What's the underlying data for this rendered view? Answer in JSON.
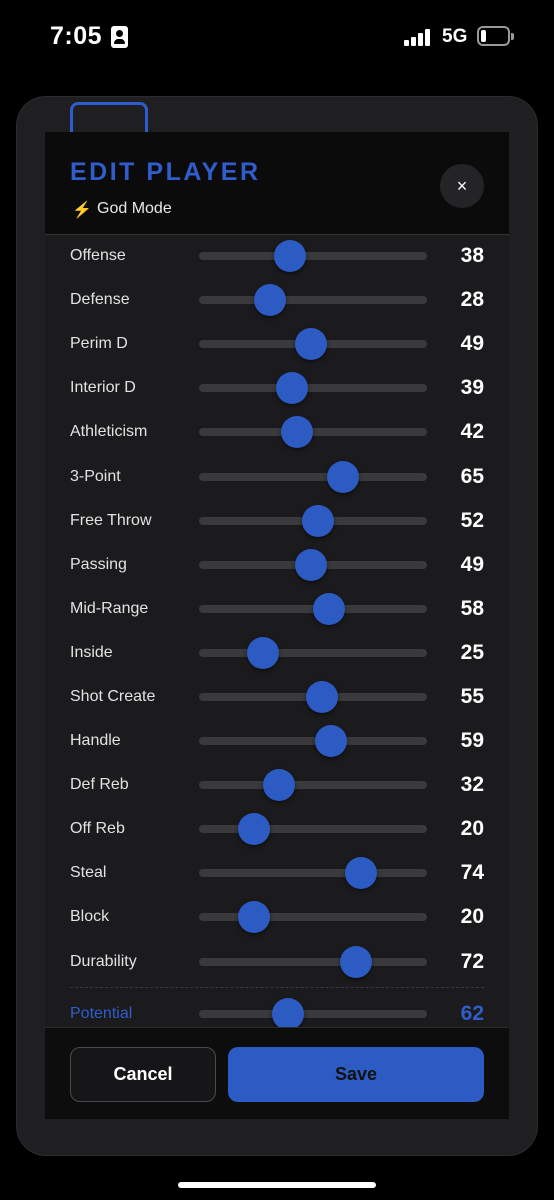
{
  "status_bar": {
    "time": "7:05",
    "network": "5G",
    "battery_level": 0.2
  },
  "modal": {
    "title": "EDIT PLAYER",
    "mode_icon": "lightning-bolt-icon",
    "mode_icon_glyph": "⚡",
    "mode_label": "God Mode",
    "close_glyph": "×",
    "accent_color": "#2d5bc4"
  },
  "attributes": [
    {
      "label": "Offense",
      "value": 38,
      "fill": 0.4
    },
    {
      "label": "Defense",
      "value": 28,
      "fill": 0.31
    },
    {
      "label": "Perim D",
      "value": 49,
      "fill": 0.49
    },
    {
      "label": "Interior D",
      "value": 39,
      "fill": 0.41
    },
    {
      "label": "Athleticism",
      "value": 42,
      "fill": 0.43
    },
    {
      "label": "3-Point",
      "value": 65,
      "fill": 0.63
    },
    {
      "label": "Free Throw",
      "value": 52,
      "fill": 0.52
    },
    {
      "label": "Passing",
      "value": 49,
      "fill": 0.49
    },
    {
      "label": "Mid-Range",
      "value": 58,
      "fill": 0.57
    },
    {
      "label": "Inside",
      "value": 25,
      "fill": 0.28
    },
    {
      "label": "Shot Create",
      "value": 55,
      "fill": 0.54
    },
    {
      "label": "Handle",
      "value": 59,
      "fill": 0.58
    },
    {
      "label": "Def Reb",
      "value": 32,
      "fill": 0.35
    },
    {
      "label": "Off Reb",
      "value": 20,
      "fill": 0.24
    },
    {
      "label": "Steal",
      "value": 74,
      "fill": 0.71
    },
    {
      "label": "Block",
      "value": 20,
      "fill": 0.24
    },
    {
      "label": "Durability",
      "value": 72,
      "fill": 0.69
    }
  ],
  "potential": {
    "label": "Potential",
    "value": 62,
    "fill": 0.39
  },
  "footer": {
    "cancel_label": "Cancel",
    "save_label": "Save"
  }
}
